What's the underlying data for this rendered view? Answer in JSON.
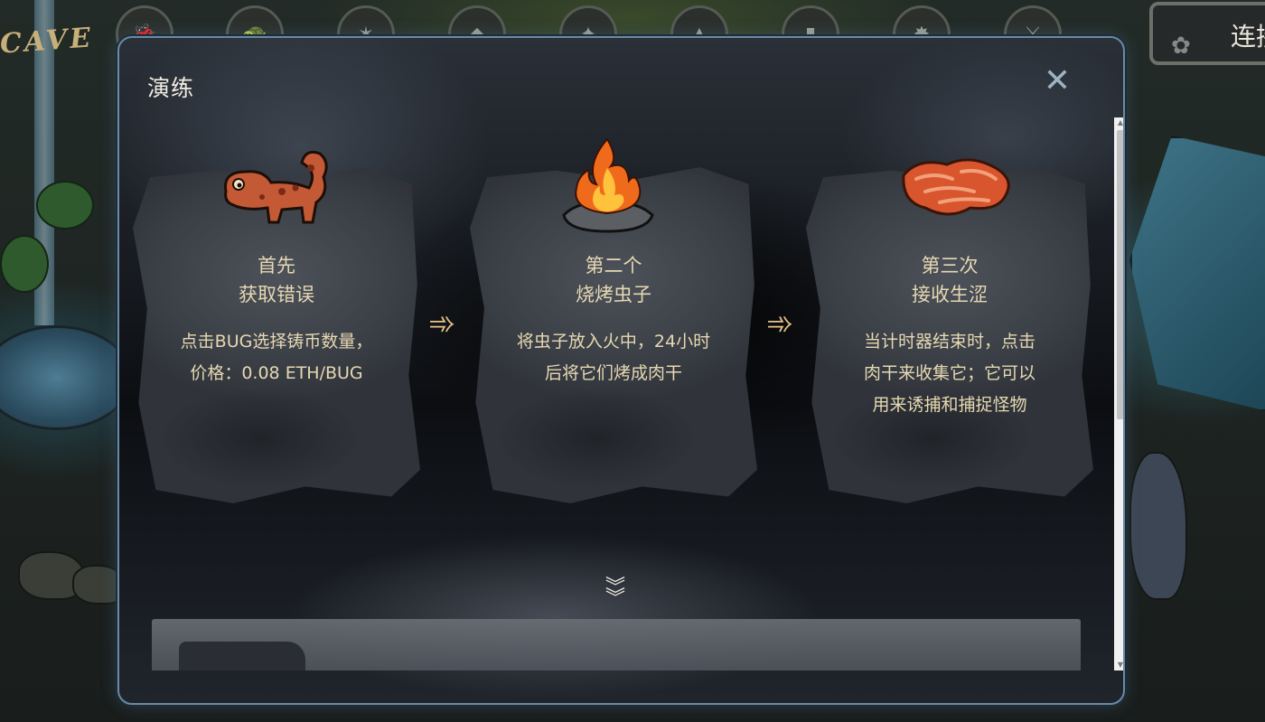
{
  "background": {
    "logo_text": "CAVE",
    "top_icons": [
      "bug-icon",
      "turtle-icon",
      "monster-icon",
      "monster-icon",
      "monster-icon",
      "monster-icon",
      "chart-icon",
      "monster-icon",
      "sword-icon"
    ],
    "connect_button_label": "连接"
  },
  "modal": {
    "title": "演练",
    "close_symbol": "✕",
    "steps": [
      {
        "heading": "首先",
        "subheading": "获取错误",
        "description_lines": [
          "点击BUG选择铸币数量，",
          "价格：0.08 ETH/BUG"
        ],
        "art": "bug-creature-icon"
      },
      {
        "heading": "第二个",
        "subheading": "烧烤虫子",
        "description_lines": [
          "将虫子放入火中，24小时",
          "后将它们烤成肉干"
        ],
        "art": "campfire-icon"
      },
      {
        "heading": "第三次",
        "subheading": "接收生涩",
        "description_lines": [
          "当计时器结束时，点击",
          "肉干来收集它；它可以",
          "用来诱捕和捕捉怪物"
        ],
        "art": "jerky-icon"
      }
    ],
    "arrow_symbol": "➾",
    "more_symbol": "︾"
  },
  "colors": {
    "accent_text": "#e6d8b2",
    "arrow": "#e8c38a",
    "modal_border": "#6b8aa6"
  }
}
